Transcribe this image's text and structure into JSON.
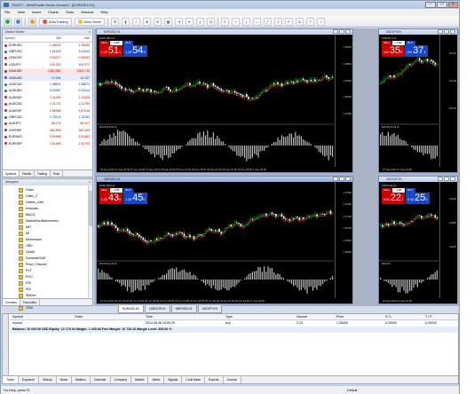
{
  "window": {
    "title": "764377 - MetaTrader Demo Account - [EURUSD,H1]"
  },
  "menu": [
    "File",
    "View",
    "Insert",
    "Charts",
    "Tools",
    "Window",
    "Help"
  ],
  "toolbar": {
    "autotrading": "AutoTrading",
    "new_order": "New Order"
  },
  "market_watch": {
    "title": "Market Watch",
    "headers": {
      "symbol": "Symbol",
      "bid": "Bid",
      "ask": "Ask"
    },
    "rows": [
      {
        "symbol": "EURUSD",
        "bid": "1.28430",
        "ask": "1.28450",
        "color": "red"
      },
      {
        "symbol": "GBPUSD",
        "bid": "1.61515",
        "ask": "1.61542",
        "color": "blue"
      },
      {
        "symbol": "USDCHF",
        "bid": "0.93227",
        "ask": "0.93252",
        "color": "red"
      },
      {
        "symbol": "USDJPY",
        "bid": "105.353",
        "ask": "105.371",
        "color": "red"
      },
      {
        "symbol": "XAUUSD",
        "bid": "1282.880",
        "ask": "1283.730",
        "color": "red"
      },
      {
        "symbol": "XAGUSD",
        "bid": "19.394",
        "ask": "19.437",
        "color": "blue"
      },
      {
        "symbol": "USDCAD",
        "bid": "1.08841",
        "ask": "1.08871",
        "color": "blue"
      },
      {
        "symbol": "AUDUSD",
        "bid": "0.93287",
        "ask": "0.93314",
        "color": "blue"
      },
      {
        "symbol": "AUDNZD",
        "bid": "1.11990",
        "ask": "1.12425",
        "color": "red"
      },
      {
        "symbol": "AUDCAD",
        "bid": "1.01731",
        "ask": "1.01780",
        "color": "red"
      },
      {
        "symbol": "AUDCHF",
        "bid": "0.86968",
        "ask": "0.87018",
        "color": "red"
      },
      {
        "symbol": "GBPCAD",
        "bid": "1.76133",
        "ask": "1.76183",
        "color": "blue"
      },
      {
        "symbol": "AUDJPY",
        "bid": "98.275",
        "ask": "98.327",
        "color": "red"
      },
      {
        "symbol": "CHFHKP",
        "bid": "260.859",
        "ask": "260.099",
        "color": "red"
      },
      {
        "symbol": "EURAUD",
        "bid": "0.91685",
        "ask": "0.91462",
        "color": "red"
      },
      {
        "symbol": "EURGBP",
        "bid": "1.61685",
        "ask": "1.61793",
        "color": "red"
      }
    ],
    "tabs": [
      "Symbols",
      "Details",
      "Trading",
      "Ticks"
    ]
  },
  "navigator": {
    "title": "Navigator",
    "items": [
      "Gator",
      "Gator_2",
      "Heiken_Ashi",
      "Ichimoku",
      "MACD",
      "MarketFacilitationIndex",
      "MFI",
      "MI",
      "Momentum",
      "OBV",
      "OsMA",
      "ParabolicSAR",
      "Price_Channel",
      "PVT",
      "ROC",
      "RSI",
      "RVI",
      "StdDev",
      "Stochastic",
      "TRIX"
    ],
    "tabs": [
      "Common",
      "Favourites"
    ]
  },
  "charts": [
    {
      "id": "c1",
      "title": "EURUSD,H1",
      "symbol": "EURUSD,H1",
      "lot": "1.00",
      "sell_small": "1.28",
      "sell_big": "51",
      "sell_sup": "1",
      "buy_small": "1.28",
      "buy_big": "54",
      "buy_sup": "3",
      "prices": [
        "1.28750",
        "1.28550",
        "1.28350",
        "1.28150",
        "1.27950"
      ],
      "indicator": "MACD(12,26,9)",
      "times": "26 Aug 2014   27 Aug 02:00   27 Aug 10:00   27 Aug 18:00   28 Aug 02:00   28 Aug 10:00   28 Aug 18:00   29 Aug 02:00   29 Aug 10:00   29 Aug 18:00   1 Sep 02:00"
    },
    {
      "id": "c2",
      "title": "USDJPY,H1",
      "symbol": "USDJPY,H1",
      "lot": "1.00",
      "sell_small": "104",
      "sell_big": "35",
      "sell_sup": "2",
      "buy_small": "104",
      "buy_big": "37",
      "buy_sup": "1",
      "prices": [
        "104.60",
        "104.40",
        "104.20"
      ],
      "indicator": "MACD(12,26,9)",
      "times": "27 Aug 2014   27 Aug 19:00"
    },
    {
      "id": "c3",
      "title": "GBPUSD,H1",
      "symbol": "EURUSD,H1",
      "lot": "1.00",
      "sell_small": "1.28",
      "sell_big": "43",
      "sell_sup": "0",
      "buy_small": "1.28",
      "buy_big": "45",
      "buy_sup": "0",
      "prices": [
        "1.37900",
        "1.37500",
        "1.37100",
        "1.36700",
        "1.36300",
        "1.35900"
      ],
      "indicator": "MACD(12,26,9)",
      "times": "19 Jun 2014   20 Jun 02:00   20 Jun 10:00   23 Jun 18:00   24 Jun 02:00   24 Jun 10:00   24 Jun 18:00   25 Jun 02:00   25 Jun 10:00   26 Jun 18:00   27 Jun 02:00"
    },
    {
      "id": "c4",
      "title": "USDCHF,H1",
      "symbol": "USDCHF,H1",
      "lot": "1.00",
      "sell_small": "0.93",
      "sell_big": "22",
      "sell_sup": "7",
      "buy_small": "0.93",
      "buy_big": "25",
      "buy_sup": "2",
      "prices": [
        "0.9330",
        "0.9300",
        "0.9270"
      ],
      "indicator": "RSI(14)",
      "times": "22 Aug 2014   22 Aug 10:00"
    }
  ],
  "chart_tabs": [
    "EURUSD,H1",
    "USDCHF,H1",
    "GBPUSD,H1",
    "USDJPY,H1"
  ],
  "terminal": {
    "headers": [
      "Symbol",
      "Order",
      "Time",
      "Type",
      "Volume",
      "Price",
      "S / L",
      "T / P"
    ],
    "rows": [
      [
        "eurusd",
        "",
        "2014.08.08 15:59:29",
        "buy",
        "2.24",
        "1.28450",
        "0.00000",
        "0.00000"
      ]
    ],
    "balance": "Balance: 10 000.00 USD  Equity: 12 175.04  Margin: 1 449.94  Free Margin: 10 725.10  Margin Level: 839.69 %",
    "tabs": [
      "Trade",
      "Exposure",
      "History",
      "News",
      "Mailbox",
      "Calendar",
      "Company",
      "Market",
      "Alerts",
      "Signals",
      "Code Base",
      "Experts",
      "Journal"
    ]
  },
  "status": {
    "left": "For Help, press F1",
    "right": "Default"
  }
}
